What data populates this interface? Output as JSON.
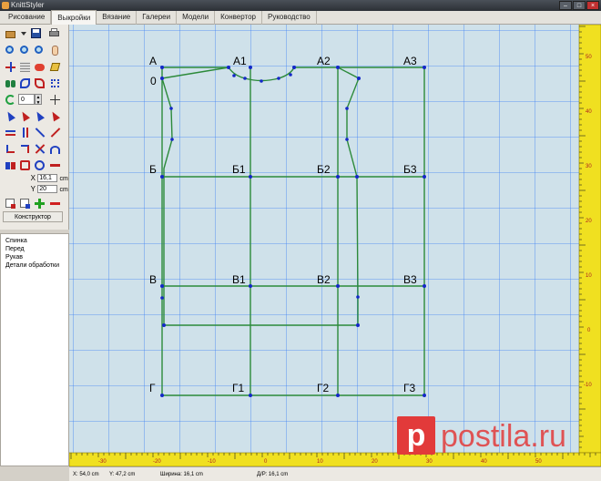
{
  "window": {
    "title": "KnittStyler"
  },
  "tabs": [
    "Рисование",
    "Выкройки",
    "Вязание",
    "Галереи",
    "Модели",
    "Конвертор",
    "Руководство"
  ],
  "active_tab": 1,
  "toolbar": {
    "spin_value": "0",
    "x_label": "X",
    "x_value": "16,1",
    "x_unit": "cm",
    "y_label": "Y",
    "y_value": "20",
    "y_unit": "cm",
    "constructor_button": "Конструктор"
  },
  "pattern_list": [
    "Спинка",
    "Перед",
    "Рукав",
    "Детали обработки"
  ],
  "drawing": {
    "point_labels": {
      "A": "А",
      "A1": "А1",
      "A2": "А2",
      "A3": "А3",
      "O": "0",
      "B": "Б",
      "B1": "Б1",
      "B2": "Б2",
      "B3": "Б3",
      "V": "В",
      "V1": "В1",
      "V2": "В2",
      "V3": "В3",
      "G": "Г",
      "G1": "Г1",
      "G2": "Г2",
      "G3": "Г3"
    },
    "colors": {
      "background": "#cfe1ea",
      "grid": "#3a7ff5",
      "pattern": "#2c8a3a",
      "points": "#1428c8",
      "ruler": "#f0e020"
    }
  },
  "ruler_bottom": [
    "-30",
    "-20",
    "-10",
    "0",
    "10",
    "20",
    "30",
    "40",
    "50"
  ],
  "ruler_right": [
    "50",
    "40",
    "30",
    "20",
    "10",
    "0",
    "-10"
  ],
  "status": {
    "x": "X: 54,0 cm",
    "y": "Y: 47,2 cm",
    "width": "Ширина: 16,1 cm",
    "length": "Д/Р: 16,1 cm"
  },
  "watermark": "postila.ru"
}
